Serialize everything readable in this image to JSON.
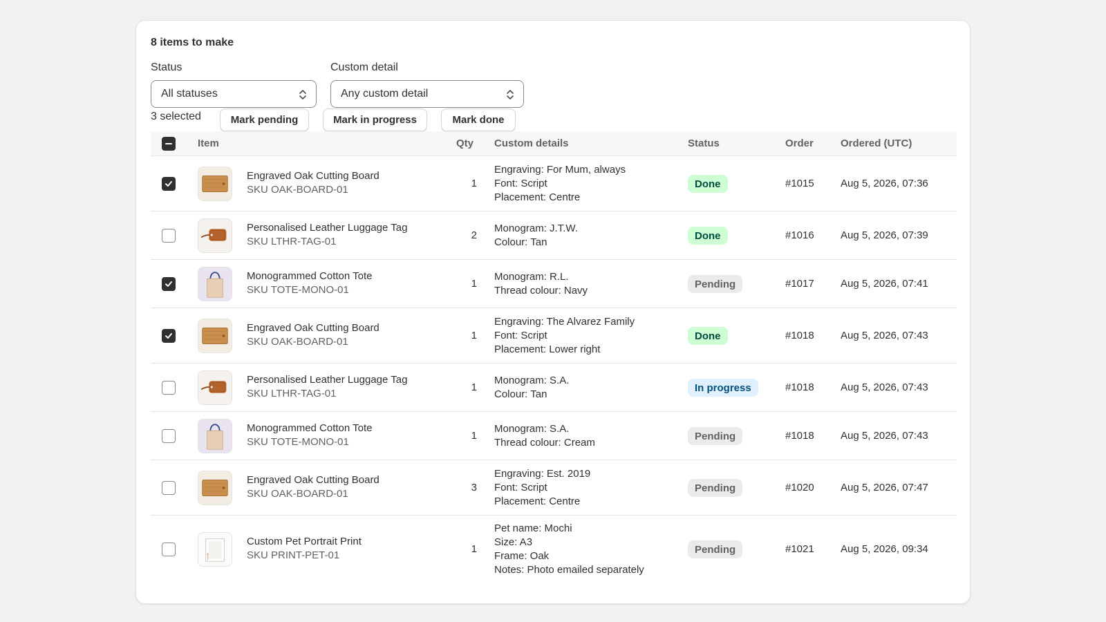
{
  "card": {
    "title": "8 items to make"
  },
  "filters": {
    "status": {
      "label": "Status",
      "value": "All statuses"
    },
    "custom_detail": {
      "label": "Custom detail",
      "value": "Any custom detail"
    }
  },
  "bulk": {
    "selected_text": "3 selected",
    "mark_pending": "Mark pending",
    "mark_in_progress": "Mark in progress",
    "mark_done": "Mark done"
  },
  "table": {
    "headers": {
      "item": "Item",
      "qty": "Qty",
      "custom_details": "Custom details",
      "status": "Status",
      "order": "Order",
      "ordered": "Ordered (UTC)"
    },
    "rows": [
      {
        "checked": true,
        "product": "board",
        "name": "Engraved Oak Cutting Board",
        "sku": "SKU OAK-BOARD-01",
        "qty": "1",
        "details": [
          "Engraving: For Mum, always",
          "Font: Script",
          "Placement: Centre"
        ],
        "status": "Done",
        "status_type": "done",
        "order": "#1015",
        "ordered": "Aug 5, 2026, 07:36"
      },
      {
        "checked": false,
        "product": "tag",
        "name": "Personalised Leather Luggage Tag",
        "sku": "SKU LTHR-TAG-01",
        "qty": "2",
        "details": [
          "Monogram: J.T.W.",
          "Colour: Tan"
        ],
        "status": "Done",
        "status_type": "done",
        "order": "#1016",
        "ordered": "Aug 5, 2026, 07:39"
      },
      {
        "checked": true,
        "product": "tote",
        "name": "Monogrammed Cotton Tote",
        "sku": "SKU TOTE-MONO-01",
        "qty": "1",
        "details": [
          "Monogram: R.L.",
          "Thread colour: Navy"
        ],
        "status": "Pending",
        "status_type": "pending",
        "order": "#1017",
        "ordered": "Aug 5, 2026, 07:41"
      },
      {
        "checked": true,
        "product": "board",
        "name": "Engraved Oak Cutting Board",
        "sku": "SKU OAK-BOARD-01",
        "qty": "1",
        "details": [
          "Engraving: The Alvarez Family",
          "Font: Script",
          "Placement: Lower right"
        ],
        "status": "Done",
        "status_type": "done",
        "order": "#1018",
        "ordered": "Aug 5, 2026, 07:43"
      },
      {
        "checked": false,
        "product": "tag",
        "name": "Personalised Leather Luggage Tag",
        "sku": "SKU LTHR-TAG-01",
        "qty": "1",
        "details": [
          "Monogram: S.A.",
          "Colour: Tan"
        ],
        "status": "In progress",
        "status_type": "progress",
        "order": "#1018",
        "ordered": "Aug 5, 2026, 07:43"
      },
      {
        "checked": false,
        "product": "tote",
        "name": "Monogrammed Cotton Tote",
        "sku": "SKU TOTE-MONO-01",
        "qty": "1",
        "details": [
          "Monogram: S.A.",
          "Thread colour: Cream"
        ],
        "status": "Pending",
        "status_type": "pending",
        "order": "#1018",
        "ordered": "Aug 5, 2026, 07:43"
      },
      {
        "checked": false,
        "product": "board",
        "name": "Engraved Oak Cutting Board",
        "sku": "SKU OAK-BOARD-01",
        "qty": "3",
        "details": [
          "Engraving: Est. 2019",
          "Font: Script",
          "Placement: Centre"
        ],
        "status": "Pending",
        "status_type": "pending",
        "order": "#1020",
        "ordered": "Aug 5, 2026, 07:47"
      },
      {
        "checked": false,
        "product": "print",
        "name": "Custom Pet Portrait Print",
        "sku": "SKU PRINT-PET-01",
        "qty": "1",
        "details": [
          "Pet name: Mochi",
          "Size: A3",
          "Frame: Oak",
          "Notes: Photo emailed separately"
        ],
        "status": "Pending",
        "status_type": "pending",
        "order": "#1021",
        "ordered": "Aug 5, 2026, 09:34"
      }
    ]
  },
  "colors": {
    "done_bg": "#cdfed4",
    "done_fg": "#014b40",
    "pending_bg": "#ebebeb",
    "pending_fg": "#616161",
    "progress_bg": "#e0f0ff",
    "progress_fg": "#00527c"
  },
  "icons": {
    "select_chevron": "select-chevron-icon",
    "checkmark": "checkmark-icon",
    "indeterminate": "minus-icon"
  }
}
